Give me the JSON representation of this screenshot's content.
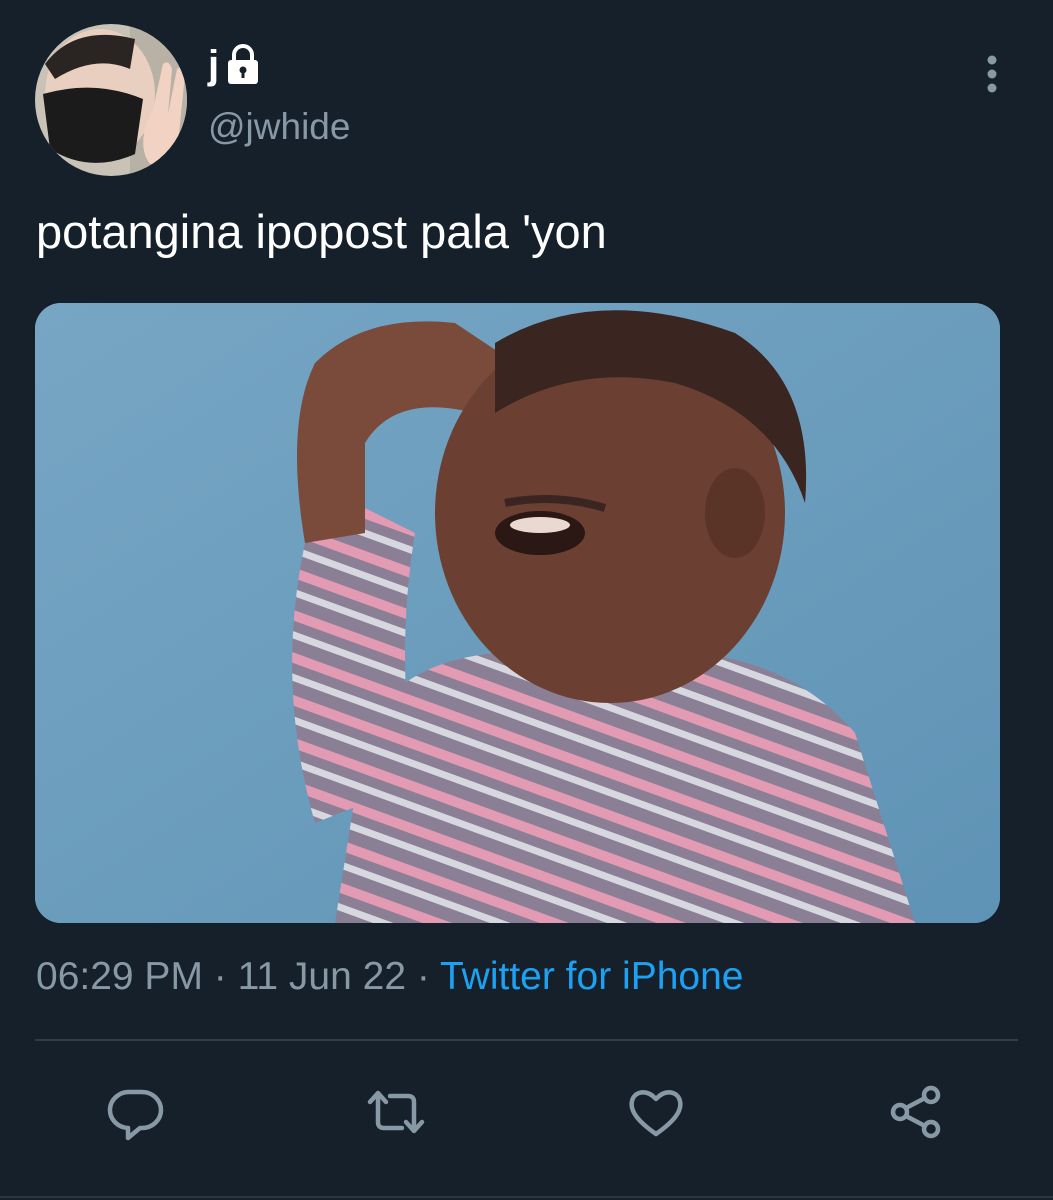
{
  "author": {
    "display_name": "j",
    "handle": "@jwhide",
    "protected": true,
    "avatar_icon": "avatar-photo"
  },
  "tweet": {
    "text": "potangina ipopost pala 'yon",
    "media_icon": "crying-child-gif",
    "time": "06:29 PM",
    "separator_1": " · ",
    "date": "11 Jun 22",
    "separator_2": " · ",
    "source": "Twitter for iPhone"
  },
  "actions": [
    {
      "name": "reply",
      "icon": "reply-icon"
    },
    {
      "name": "retweet",
      "icon": "retweet-icon"
    },
    {
      "name": "like",
      "icon": "heart-icon"
    },
    {
      "name": "share",
      "icon": "share-icon"
    }
  ],
  "colors": {
    "background": "#16202b",
    "primary_text": "#ffffff",
    "secondary_text": "#8899a6",
    "link": "#1da1f2",
    "divider": "#2f3c49"
  }
}
